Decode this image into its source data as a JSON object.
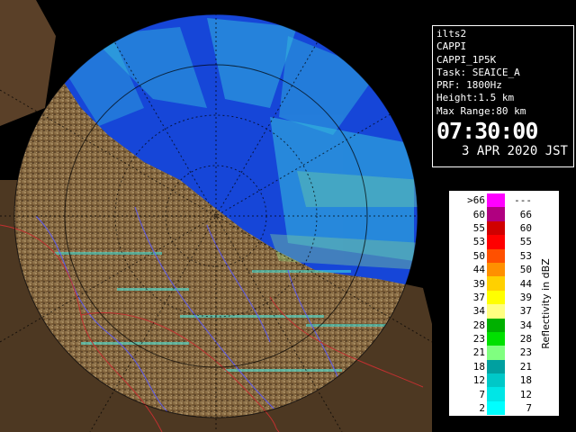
{
  "info": {
    "site": "ilts2",
    "product": "CAPPI",
    "product_code": "CAPPI_1P5K",
    "task": "Task: SEAICE_A",
    "prf": "PRF: 1800Hz",
    "height": "Height:1.5 km",
    "max_range": "Max Range:80 km",
    "time": "07:30:00",
    "date": "3 APR 2020 JST"
  },
  "legend": {
    "title": "Reflectivity in dBZ",
    "rows": [
      {
        "lo": ">66",
        "hi": "---",
        "color": "#ff00ff"
      },
      {
        "lo": "60",
        "hi": "66",
        "color": "#b00080"
      },
      {
        "lo": "55",
        "hi": "60",
        "color": "#d00000"
      },
      {
        "lo": "53",
        "hi": "55",
        "color": "#ff0000"
      },
      {
        "lo": "50",
        "hi": "53",
        "color": "#ff5000"
      },
      {
        "lo": "44",
        "hi": "50",
        "color": "#ff9000"
      },
      {
        "lo": "39",
        "hi": "44",
        "color": "#ffd000"
      },
      {
        "lo": "37",
        "hi": "39",
        "color": "#ffff00"
      },
      {
        "lo": "34",
        "hi": "37",
        "color": "#ffff80"
      },
      {
        "lo": "28",
        "hi": "34",
        "color": "#00b000"
      },
      {
        "lo": "23",
        "hi": "28",
        "color": "#00e000"
      },
      {
        "lo": "21",
        "hi": "23",
        "color": "#80ff80"
      },
      {
        "lo": "18",
        "hi": "21",
        "color": "#00a0a0"
      },
      {
        "lo": "12",
        "hi": "18",
        "color": "#00c8c8"
      },
      {
        "lo": "7",
        "hi": "12",
        "color": "#00e6e6"
      },
      {
        "lo": "2",
        "hi": "7",
        "color": "#00ffff"
      }
    ]
  },
  "colors": {
    "sea": "#1646d8",
    "land": "#8b6a3e",
    "echo": "#40e8e0",
    "rivers": "#5a5aff",
    "borders": "#c03030"
  }
}
